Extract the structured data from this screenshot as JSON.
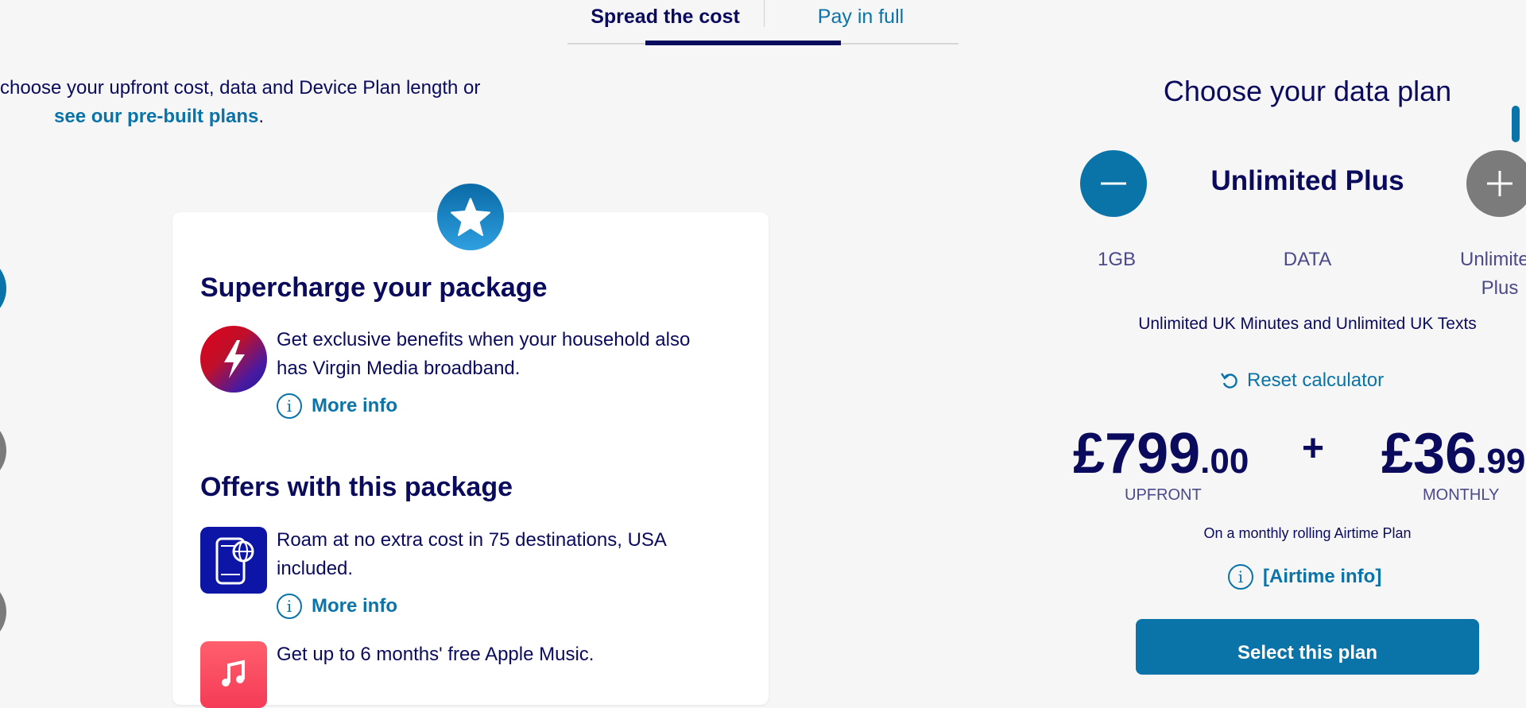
{
  "tabs": {
    "spread_label": "Spread the cost",
    "full_label": "Pay in full"
  },
  "intro": {
    "line1": "choose your upfront cost, data and Device Plan length or",
    "link": "see our pre-built plans",
    "period": "."
  },
  "card": {
    "supercharge_title": "Supercharge your package",
    "broadband_text": "Get exclusive benefits when your household also has Virgin Media broadband.",
    "more_info_1": "More info",
    "offers_title": "Offers with this package",
    "roam_text": "Roam at no extra cost in 75 destinations, USA included.",
    "more_info_2": "More info",
    "music_text": "Get up to 6 months' free Apple Music."
  },
  "data_plan": {
    "title": "Choose your data plan",
    "plan_name": "Unlimited Plus",
    "scale_min": "1GB",
    "scale_mid": "DATA",
    "scale_max": "Unlimited Plus",
    "allowance": "Unlimited UK Minutes and Unlimited UK Texts",
    "reset_label": "Reset calculator",
    "upfront_whole": "£799",
    "upfront_dec": ".00",
    "upfront_caption": "UPFRONT",
    "plus": "+",
    "monthly_whole": "£36",
    "monthly_dec": ".99",
    "monthly_caption": "MONTHLY",
    "rolling_text": "On a monthly rolling Airtime Plan",
    "airtime_label": "[Airtime info]",
    "select_label": "Select this plan"
  },
  "icons": [
    "star-icon",
    "lightning-icon",
    "info-icon",
    "roaming-phone-icon",
    "music-icon",
    "minus-icon",
    "plus-icon",
    "reset-icon"
  ],
  "colors": {
    "navy": "#0b0b5e",
    "brand_blue": "#0a73a8",
    "inactive_grey": "#7b7b7b",
    "background": "#f6f6f6"
  }
}
